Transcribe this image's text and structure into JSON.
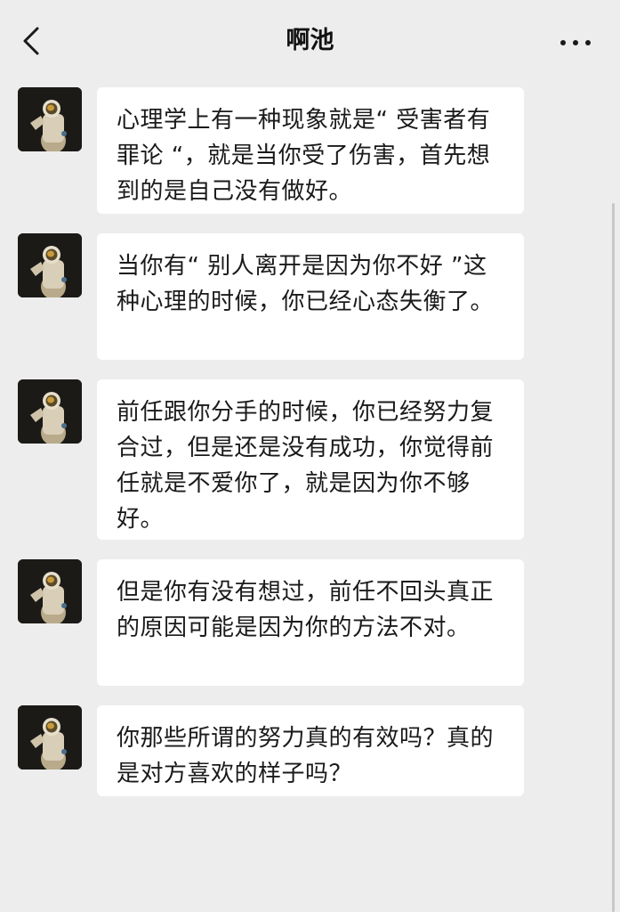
{
  "header": {
    "title": "啊池",
    "back_icon": "chevron-left-icon",
    "more_icon": "more-horizontal-icon"
  },
  "messages": [
    {
      "text": "心理学上有一种现象就是“ 受害者有罪论 “，就是当你受了伤害，首先想到的是自己没有做好。"
    },
    {
      "text": "当你有“ 别人离开是因为你不好 ”这种心理的时候，你已经心态失衡了。"
    },
    {
      "text": "前任跟你分手的时候，你已经努力复合过，但是还是没有成功，你觉得前任就是不爱你了，就是因为你不够好。"
    },
    {
      "text": "但是你有没有想过，前任不回头真正的原因可能是因为你的方法不对。"
    },
    {
      "text": "你那些所谓的努力真的有效吗？真的是对方喜欢的样子吗？"
    }
  ],
  "avatar_icon": "astronaut-avatar",
  "colors": {
    "background": "#ededed",
    "bubble": "#ffffff",
    "text": "#1a1a1a"
  }
}
